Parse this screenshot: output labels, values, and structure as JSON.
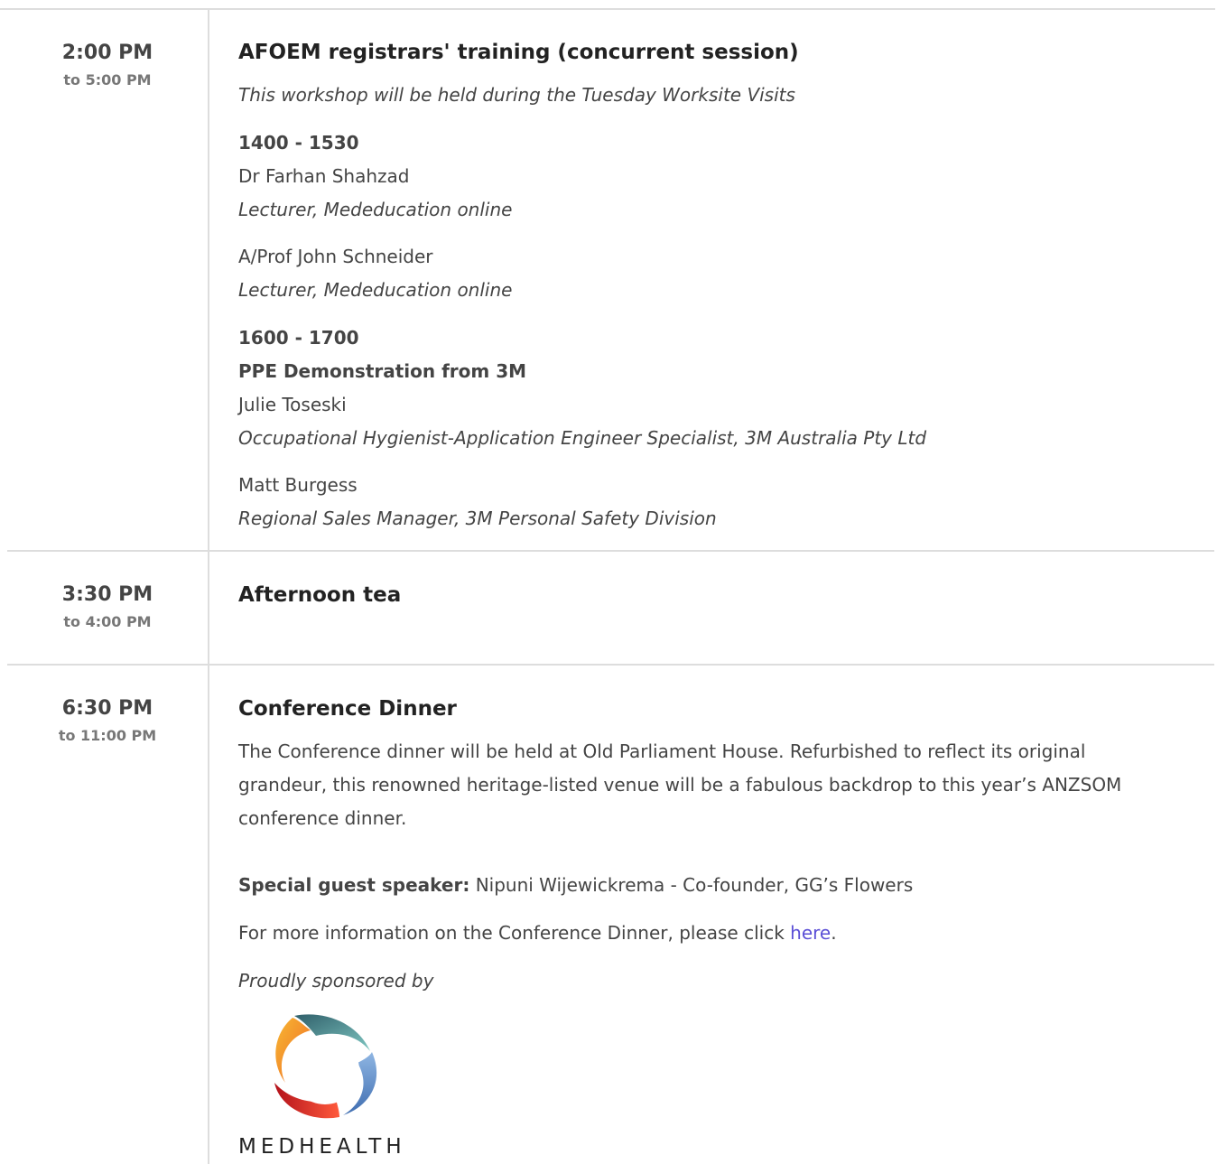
{
  "sessions": [
    {
      "start": "2:00 PM",
      "end": "to 5:00 PM",
      "title": "AFOEM registrars' training (concurrent session)",
      "note": "This workshop will be held during the Tuesday Worksite Visits",
      "blocks": [
        {
          "time": "1400 - 1530"
        },
        {
          "name": "Dr Farhan Shahzad",
          "role": "Lecturer, Mededucation online"
        },
        {
          "name": "A/Prof John Schneider",
          "role": "Lecturer, Mededucation online"
        },
        {
          "time": "1600 - 1700",
          "subtitle": "PPE Demonstration from 3M"
        },
        {
          "name": "Julie Toseski",
          "role": "Occupational Hygienist-Application Engineer Specialist, 3M Australia Pty Ltd"
        },
        {
          "name": "Matt Burgess",
          "role": "Regional Sales Manager, 3M Personal Safety Division"
        }
      ]
    },
    {
      "start": "3:30 PM",
      "end": "to 4:00 PM",
      "title": "Afternoon tea"
    },
    {
      "start": "6:30 PM",
      "end": "to 11:00 PM",
      "title": "Conference Dinner",
      "description": "The Conference dinner will be held at Old Parliament House. Refurbished to reflect its original grandeur, this renowned heritage-listed venue will be a fabulous backdrop to this year’s ANZSOM conference dinner.",
      "guest_label": "Special guest speaker:",
      "guest_value": "Nipuni Wijewickrema - Co-founder, GG’s Flowers",
      "info_prefix": "For more information on the Conference Dinner, please click",
      "info_link": "here",
      "info_suffix": ".",
      "sponsor_text": "Proudly sponsored by",
      "sponsor_logo_text": "MEDHEALTH"
    }
  ],
  "colors": {
    "link": "#5b4fd6",
    "divider": "#dddddd",
    "logo_orange": "#f39a2b",
    "logo_teal": "#3f7f86",
    "logo_blue": "#5f8fc9",
    "logo_red": "#e0312f"
  }
}
